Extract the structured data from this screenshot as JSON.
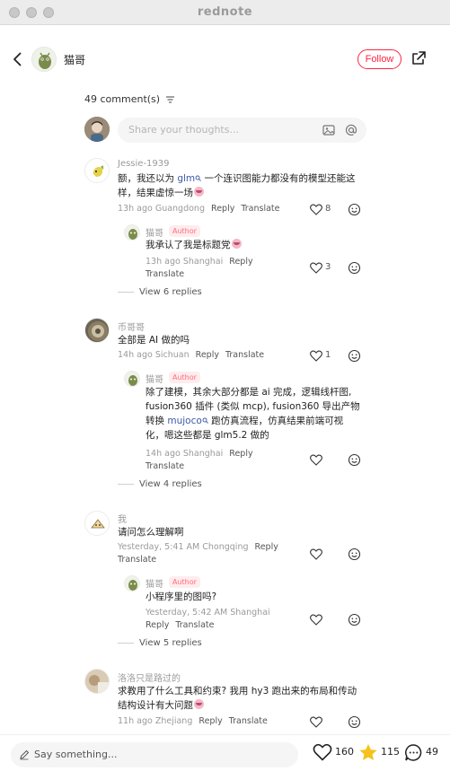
{
  "window": {
    "title": "rednote"
  },
  "header": {
    "author_name": "猫哥",
    "follow_label": "Follow"
  },
  "comments_header": {
    "count_label": "49 comment(s)"
  },
  "share_input": {
    "placeholder": "Share your thoughts..."
  },
  "comments": [
    {
      "user": "Jessie-1939",
      "text_before": "额，我还以为 ",
      "link": "glm",
      "text_after": " 一个连识图能力都没有的模型还能这样，结果虚惊一场",
      "time": "13h ago",
      "location": "Guangdong",
      "reply_label": "Reply",
      "translate_label": "Translate",
      "likes": "8",
      "reply": {
        "user": "猫哥",
        "author_tag": "Author",
        "text": "我承认了我是标题党",
        "time": "13h ago",
        "location": "Shanghai",
        "reply_label": "Reply",
        "translate_label": "Translate",
        "likes": "3"
      },
      "view_replies": "View 6 replies"
    },
    {
      "user": "币哥哥",
      "text": "全部是 AI 做的吗",
      "time": "14h ago",
      "location": "Sichuan",
      "reply_label": "Reply",
      "translate_label": "Translate",
      "likes": "1",
      "reply": {
        "user": "猫哥",
        "author_tag": "Author",
        "text_line1": "除了建模，其余大部分都是 ai 完成，逻辑线杆图,",
        "text_line2": "fusion360 插件 (类似 mcp), fusion360 导出产物",
        "text_line3_before": "转换 ",
        "text_line3_link": "mujoco",
        "text_line3_after": " 跑仿真流程，仿真结果前端可视",
        "text_line4": "化，嗯这些都是 glm5.2 做的",
        "time": "14h ago",
        "location": "Shanghai",
        "reply_label": "Reply",
        "translate_label": "Translate"
      },
      "view_replies": "View 4 replies"
    },
    {
      "user": "我",
      "text": "请问怎么理解啊",
      "time": "Yesterday, 5:41 AM",
      "location": "Chongqing",
      "reply_label": "Reply",
      "translate_label": "Translate",
      "reply": {
        "user": "猫哥",
        "author_tag": "Author",
        "text": "小程序里的图吗?",
        "time": "Yesterday, 5:42 AM",
        "location": "Shanghai",
        "reply_label": "Reply",
        "translate_label": "Translate"
      },
      "view_replies": "View 5 replies"
    },
    {
      "user": "洛洛只是路过的",
      "text_line1": "求教用了什么工具和约束? 我用 hy3 跑出来的布局和传动",
      "text_line2": "结构设计有大问题",
      "time": "11h ago",
      "location": "Zhejiang",
      "reply_label": "Reply",
      "translate_label": "Translate"
    }
  ],
  "bottom": {
    "placeholder": "Say something...",
    "likes": "160",
    "stars": "115",
    "comments": "49"
  },
  "colors": {
    "accent": "#ff2442",
    "link": "#3b5aa8",
    "star": "#f5c21b"
  },
  "icons": {
    "back": "chevron-left-icon",
    "share": "share-external-icon",
    "filter": "filter-icon",
    "image": "image-icon",
    "mention": "at-icon",
    "heart": "heart-icon",
    "emoji": "emoji-icon",
    "pencil": "pencil-icon",
    "star": "star-icon",
    "comment": "comment-bubble-icon"
  }
}
